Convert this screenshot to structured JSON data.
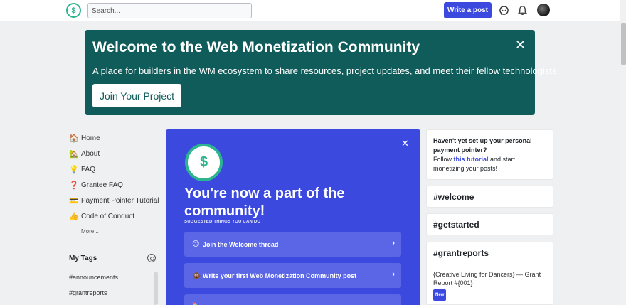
{
  "header": {
    "logo_text": "$",
    "search_placeholder": "Search...",
    "write_post_label": "Write a post"
  },
  "banner": {
    "title": "Welcome to the Web Monetization Community",
    "subtitle": "A place for builders in the WM ecosystem to share resources, project updates, and meet their fellow technologists.",
    "button_label": "Join Your Project",
    "close_symbol": "✕"
  },
  "nav": {
    "items": [
      {
        "emoji": "🏠",
        "label": "Home"
      },
      {
        "emoji": "🏡",
        "label": "About"
      },
      {
        "emoji": "💡",
        "label": "FAQ"
      },
      {
        "emoji": "❓",
        "label": "Grantee FAQ"
      },
      {
        "emoji": "💳",
        "label": "Payment Pointer Tutorial"
      },
      {
        "emoji": "👍",
        "label": "Code of Conduct"
      }
    ],
    "more_label": "More..."
  },
  "tags": {
    "title": "My Tags",
    "items": [
      "#announcements",
      "#grantreports"
    ]
  },
  "onboarding": {
    "logo_text": "$",
    "close_symbol": "✕",
    "title": "You're now a part of the community!",
    "subtitle": "SUGGESTED THINGS YOU CAN DO",
    "items": [
      {
        "emoji": "😊",
        "label": "Join the Welcome thread"
      },
      {
        "emoji": "💩",
        "label": "Write your first Web Monetization Community post"
      },
      {
        "emoji": "✏️",
        "label": ""
      }
    ],
    "chevron": "›"
  },
  "right_sidebar": {
    "note": {
      "bold": "Haven't yet set up your personal payment pointer?",
      "pre": "Follow ",
      "link": "this tutorial",
      "post": " and start monetizing your posts!"
    },
    "tag_cards": [
      "#welcome",
      "#getstarted"
    ],
    "grant_card": {
      "title": "#grantreports",
      "post_title": "{Creative Living for Dancers} — Grant Report #{001}",
      "badge": "New"
    }
  },
  "colors": {
    "accent": "#3b49df",
    "banner_bg": "#0f5c5a",
    "brand_green": "#2cb38f"
  }
}
